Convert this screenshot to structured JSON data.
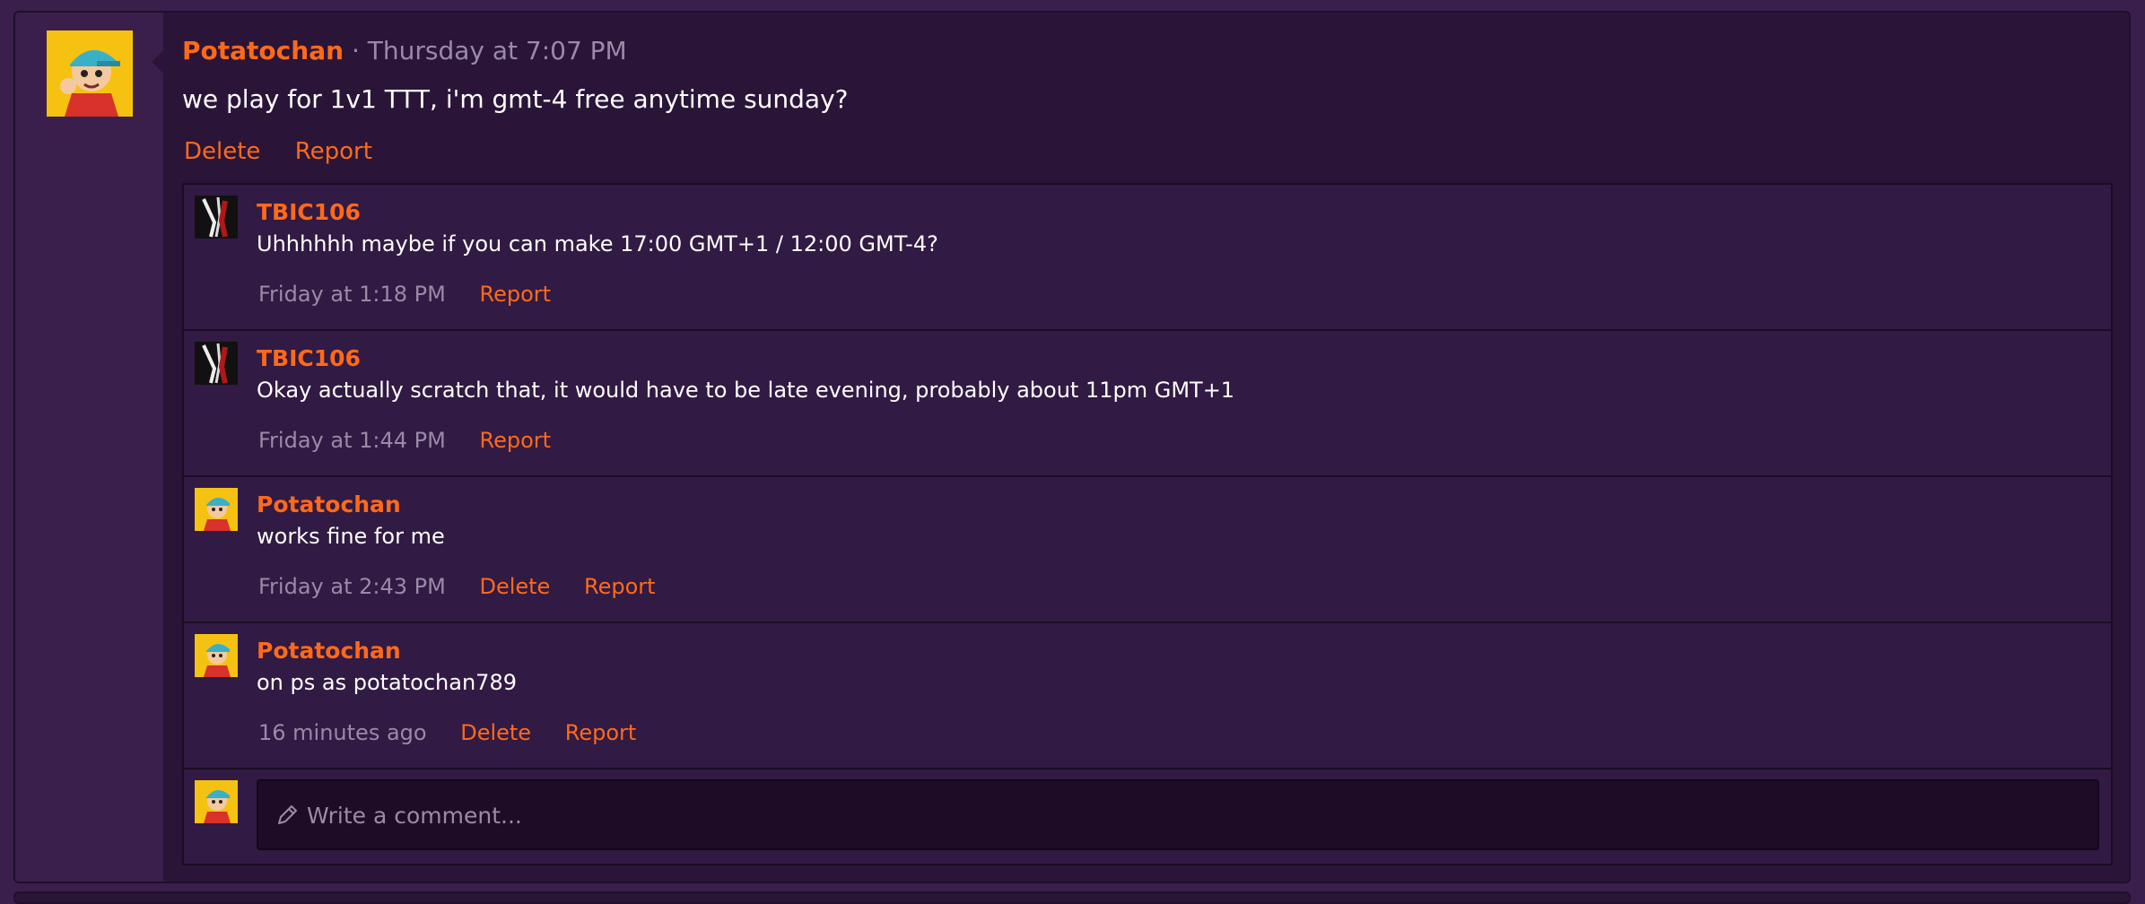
{
  "post": {
    "author": "Potatochan",
    "separator": "·",
    "time": "Thursday at 7:07 PM",
    "body": "we play for 1v1 TTT, i'm gmt-4 free anytime sunday?",
    "actions": {
      "delete": "Delete",
      "report": "Report"
    }
  },
  "comments": [
    {
      "author": "TBIC106",
      "text": "Uhhhhhh maybe if you can make 17:00 GMT+1 / 12:00 GMT-4?",
      "time": "Friday at 1:18 PM",
      "report": "Report"
    },
    {
      "author": "TBIC106",
      "text": "Okay actually scratch that, it would have to be late evening, probably about 11pm GMT+1",
      "time": "Friday at 1:44 PM",
      "report": "Report"
    },
    {
      "author": "Potatochan",
      "text": "works fine for me",
      "time": "Friday at 2:43 PM",
      "delete": "Delete",
      "report": "Report"
    },
    {
      "author": "Potatochan",
      "text": "on ps as potatochan789",
      "time": "16 minutes ago",
      "delete": "Delete",
      "report": "Report"
    }
  ],
  "comment_box": {
    "placeholder": "Write a comment...",
    "icon": "pencil-icon"
  },
  "colors": {
    "accent": "#ff6a1a",
    "background": "#3a1f4d",
    "panel": "#2a1538",
    "muted": "#9a8aa6"
  }
}
